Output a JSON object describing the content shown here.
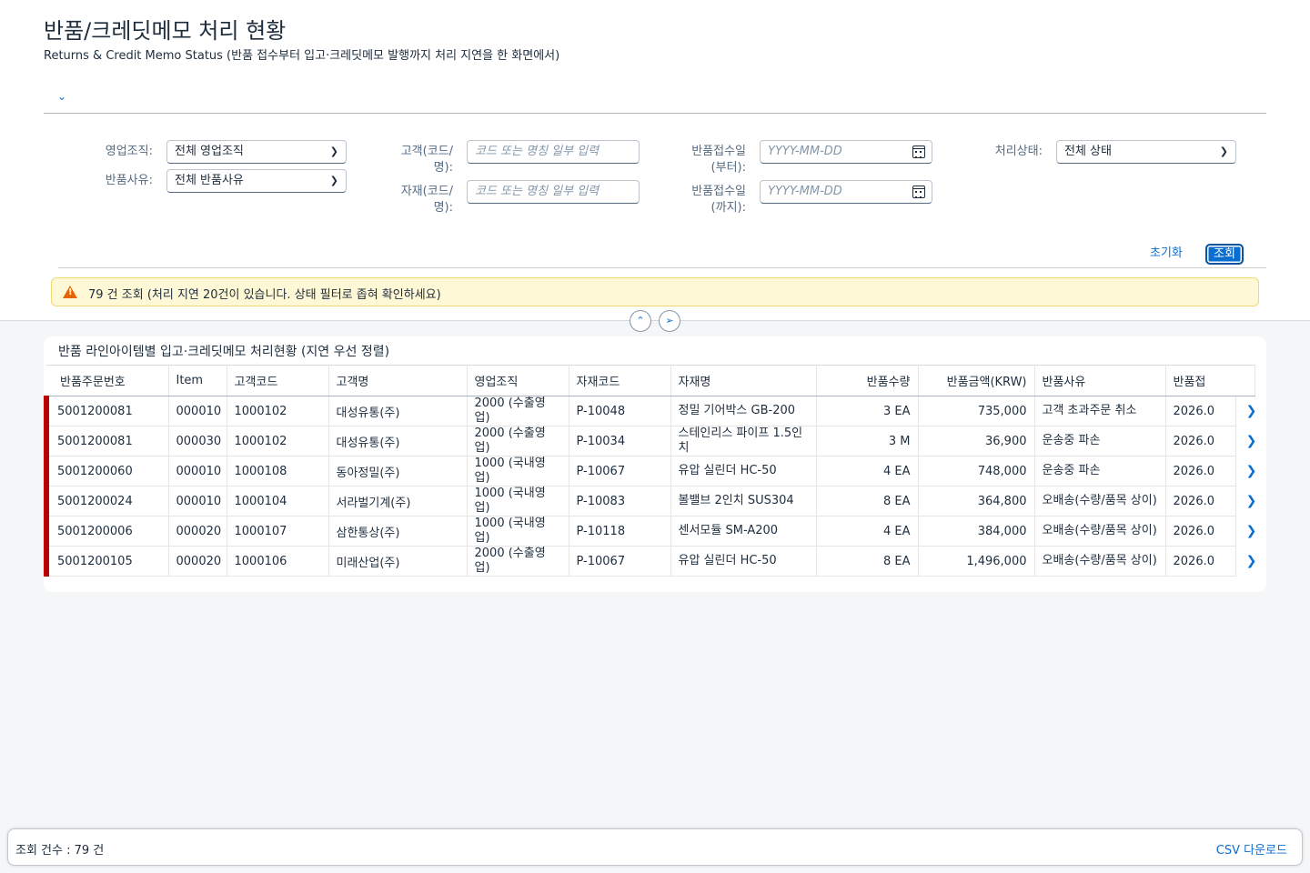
{
  "page": {
    "title": "반품/크레딧메모 처리 현황",
    "subtitle": "Returns & Credit Memo Status (반품 접수부터 입고·크레딧메모 발행까지 처리 지연을 한 화면에서)"
  },
  "filters": {
    "sales_org_label": "영업조직:",
    "sales_org_value": "전체 영업조직",
    "return_reason_label": "반품사유:",
    "return_reason_value": "전체 반품사유",
    "customer_label_1": "고객(코드/",
    "customer_label_2": "명):",
    "customer_placeholder": "코드 또는 명칭 일부 입력",
    "material_label_1": "자재(코드/",
    "material_label_2": "명):",
    "material_placeholder": "코드 또는 명칭 일부 입력",
    "date_from_label_1": "반품접수일",
    "date_from_label_2": "(부터):",
    "date_from_placeholder": "YYYY-MM-DD",
    "date_to_label_1": "반품접수일",
    "date_to_label_2": "(까지):",
    "date_to_placeholder": "YYYY-MM-DD",
    "status_label": "처리상태:",
    "status_value": "전체 상태",
    "reset_label": "초기화",
    "search_label": "조회"
  },
  "message": {
    "text": "79 건 조회 (처리 지연 20건이 있습니다. 상태 필터로 좁혀 확인하세요)"
  },
  "table": {
    "title": "반품 라인아이템별 입고·크레딧메모 처리현황 (지연 우선 정렬)",
    "columns": [
      "반품주문번호",
      "Item",
      "고객코드",
      "고객명",
      "영업조직",
      "자재코드",
      "자재명",
      "반품수량",
      "반품금액(KRW)",
      "반품사유",
      "반품접"
    ],
    "rows": [
      [
        "5001200081",
        "000010",
        "1000102",
        "대성유통(주)",
        "2000 (수출영업)",
        "P-10048",
        "정밀 기어박스 GB-200",
        "3 EA",
        "735,000",
        "고객 초과주문 취소",
        "2026.0"
      ],
      [
        "5001200081",
        "000030",
        "1000102",
        "대성유통(주)",
        "2000 (수출영업)",
        "P-10034",
        "스테인리스 파이프 1.5인치",
        "3 M",
        "36,900",
        "운송중 파손",
        "2026.0"
      ],
      [
        "5001200060",
        "000010",
        "1000108",
        "동아정밀(주)",
        "1000 (국내영업)",
        "P-10067",
        "유압 실린더 HC-50",
        "4 EA",
        "748,000",
        "운송중 파손",
        "2026.0"
      ],
      [
        "5001200024",
        "000010",
        "1000104",
        "서라벌기계(주)",
        "1000 (국내영업)",
        "P-10083",
        "볼밸브 2인치 SUS304",
        "8 EA",
        "364,800",
        "오배송(수량/품목 상이)",
        "2026.0"
      ],
      [
        "5001200006",
        "000020",
        "1000107",
        "삼한통상(주)",
        "1000 (국내영업)",
        "P-10118",
        "센서모듈 SM-A200",
        "4 EA",
        "384,000",
        "오배송(수량/품목 상이)",
        "2026.0"
      ],
      [
        "5001200105",
        "000020",
        "1000106",
        "미래산업(주)",
        "2000 (수출영업)",
        "P-10067",
        "유압 실린더 HC-50",
        "8 EA",
        "1,496,000",
        "오배송(수량/품목 상이)",
        "2026.0"
      ]
    ],
    "row_status_color": "#bb0000"
  },
  "footer": {
    "count_text": "조회 건수 : 79 건",
    "csv_label": "CSV 다운로드"
  },
  "icons": {
    "expand": "chevron-down-icon",
    "collapse": "chevron-up-icon",
    "pin": "pin-icon",
    "calendar": "calendar-icon",
    "warning": "warning-icon",
    "row_nav": "chevron-right-icon"
  },
  "colors": {
    "accent": "#0a6ed1",
    "warning_bg": "#fff8d6",
    "warning_icon": "#e76500",
    "delay_marker": "#bb0000"
  }
}
